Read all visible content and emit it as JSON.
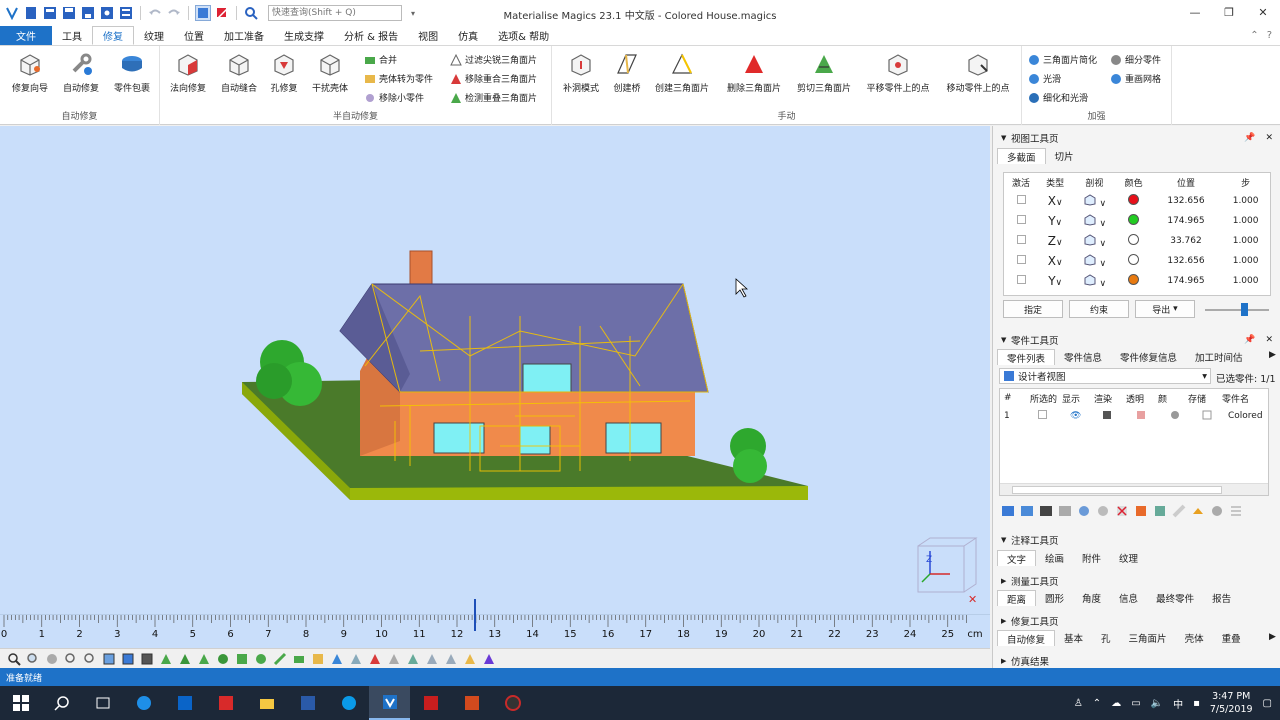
{
  "window": {
    "title": "Materialise Magics 23.1 中文版 - Colored House.magics",
    "quick_search_placeholder": "快速查询(Shift + Q)",
    "controls": {
      "minimize": "—",
      "restore": "❐",
      "close": "✕"
    }
  },
  "menu": {
    "tabs": [
      "文件",
      "工具",
      "修复",
      "纹理",
      "位置",
      "加工准备",
      "生成支撑",
      "分析 & 报告",
      "视图",
      "仿真",
      "选项& 帮助"
    ],
    "active_index": 2
  },
  "ribbon": {
    "groups": {
      "auto_fix": "自动修复",
      "semi_auto_fix": "半自动修复",
      "manual": "手动",
      "enhance": "加强"
    },
    "auto_fix_buttons": [
      "修复向导",
      "自动修复",
      "零件包裹"
    ],
    "semi_auto_big_buttons": [
      "法向修复",
      "自动缝合",
      "孔修复",
      "干扰壳体"
    ],
    "semi_auto_small_col1": [
      "合并",
      "壳体转为零件",
      "移除小零件"
    ],
    "semi_auto_small_col2": [
      "过滤尖锐三角面片",
      "移除重合三角面片",
      "检测重叠三角面片"
    ],
    "manual_buttons": [
      "补洞模式",
      "创建桥",
      "创建三角面片",
      "删除三角面片",
      "剪切三角面片",
      "平移零件上的点",
      "移动零件上的点"
    ],
    "enhance_col1": [
      "三角面片简化",
      "光滑",
      "细化和光滑"
    ],
    "enhance_col2": [
      "细分零件",
      "重画网格"
    ]
  },
  "viewport": {
    "ruler_unit": "cm",
    "ruler_ticks": [
      "0",
      "1",
      "2",
      "3",
      "4",
      "5",
      "6",
      "7",
      "8",
      "9",
      "10",
      "11",
      "12",
      "13",
      "14",
      "15",
      "16",
      "17",
      "18",
      "19",
      "20",
      "21",
      "22",
      "23",
      "24",
      "25"
    ],
    "axis_label": "Z"
  },
  "view_toolbox": {
    "title": "视图工具页",
    "tabs": [
      "多截面",
      "切片"
    ],
    "headers": [
      "激活",
      "类型",
      "剖视",
      "颜色",
      "位置",
      "步"
    ],
    "rows": [
      {
        "axis": "X",
        "color": "#e8101a",
        "position": "132.656",
        "step": "1.000"
      },
      {
        "axis": "Y",
        "color": "#22cc22",
        "position": "174.965",
        "step": "1.000"
      },
      {
        "axis": "Z",
        "color": "#ffffff",
        "position": "33.762",
        "step": "1.000"
      },
      {
        "axis": "X",
        "color": "#ffffff",
        "position": "132.656",
        "step": "1.000"
      },
      {
        "axis": "Y",
        "color": "#e87a10",
        "position": "174.965",
        "step": "1.000"
      }
    ],
    "buttons": {
      "assign": "指定",
      "constrain": "约束",
      "export": "导出"
    }
  },
  "part_toolbox": {
    "title": "零件工具页",
    "tabs": [
      "零件列表",
      "零件信息",
      "零件修复信息",
      "加工时间估"
    ],
    "view_select": "设计者视图",
    "selected_count": "已选零件: 1/1",
    "headers": [
      "#",
      "所选的",
      "显示",
      "渲染",
      "透明",
      "颜",
      "存储",
      "零件名"
    ],
    "row": {
      "index": "1",
      "name": "Colored"
    }
  },
  "annotation_toolbox": {
    "title": "注释工具页",
    "tabs": [
      "文字",
      "绘画",
      "附件",
      "纹理"
    ]
  },
  "measure_toolbox": {
    "title": "测量工具页",
    "tabs": [
      "距离",
      "圆形",
      "角度",
      "信息",
      "最终零件",
      "报告"
    ]
  },
  "fix_toolbox": {
    "title": "修复工具页",
    "tabs": [
      "自动修复",
      "基本",
      "孔",
      "三角面片",
      "壳体",
      "重叠"
    ]
  },
  "sim_results": {
    "title": "仿真结果"
  },
  "status": {
    "text": "准备就绪"
  },
  "taskbar": {
    "time": "3:47 PM",
    "date": "7/5/2019",
    "ime": "中"
  },
  "colors": {
    "accent": "#1e72c8",
    "viewport_bg": "#c9defa",
    "roof": "#6d6fa8",
    "wall": "#f08a4b",
    "grass": "#4a7a2a",
    "tree": "#2ea82e",
    "wire": "#f5c400"
  }
}
